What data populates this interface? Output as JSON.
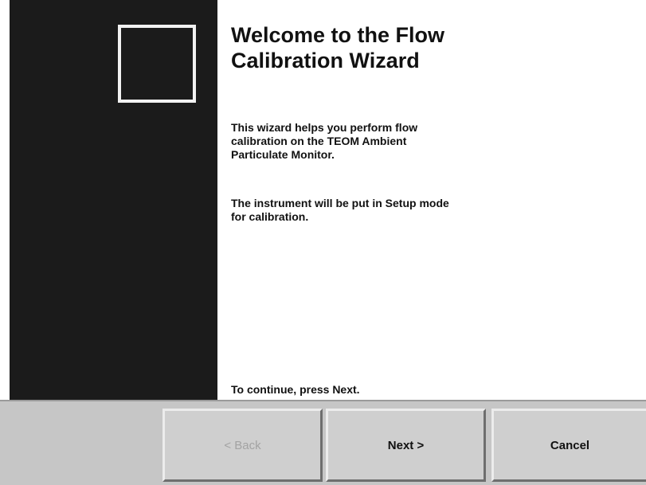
{
  "wizard": {
    "title": "Welcome to the Flow\nCalibration Wizard",
    "paragraphs": [
      "This wizard helps you perform flow\ncalibration on the TEOM  Ambient\nParticulate Monitor.",
      "The instrument will be put in Setup mode\nfor calibration.",
      "To continue, press Next."
    ]
  },
  "buttons": {
    "back": {
      "label": "< Back",
      "enabled": false
    },
    "next": {
      "label": "Next >",
      "enabled": true
    },
    "cancel": {
      "label": "Cancel",
      "enabled": true
    }
  },
  "colors": {
    "side_panel": "#1b1b1b",
    "logo_frame": "#f2f2f2",
    "button_bar": "#c6c6c6",
    "disabled_text": "#a3a3a3"
  }
}
